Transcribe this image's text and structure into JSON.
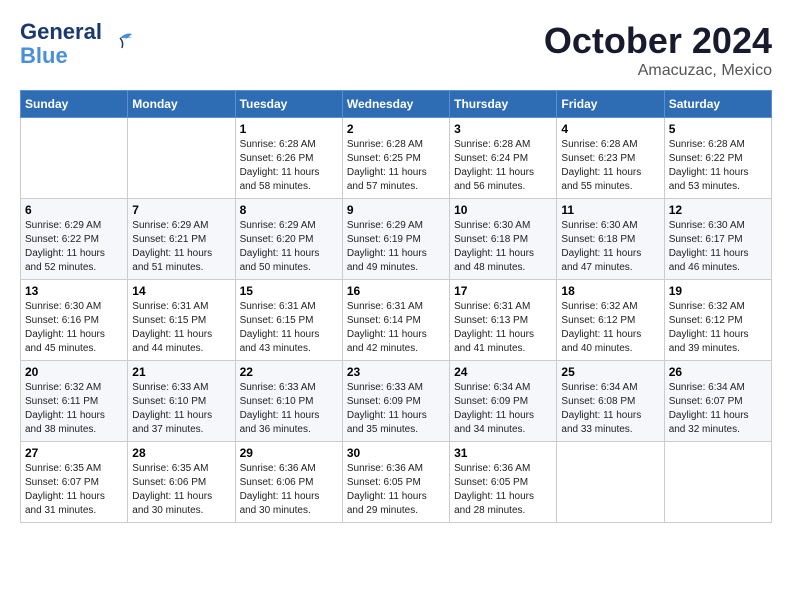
{
  "header": {
    "logo_line1": "General",
    "logo_line2": "Blue",
    "month": "October 2024",
    "location": "Amacuzac, Mexico"
  },
  "days_of_week": [
    "Sunday",
    "Monday",
    "Tuesday",
    "Wednesday",
    "Thursday",
    "Friday",
    "Saturday"
  ],
  "weeks": [
    [
      {
        "day": "",
        "info": ""
      },
      {
        "day": "",
        "info": ""
      },
      {
        "day": "1",
        "info": "Sunrise: 6:28 AM\nSunset: 6:26 PM\nDaylight: 11 hours and 58 minutes."
      },
      {
        "day": "2",
        "info": "Sunrise: 6:28 AM\nSunset: 6:25 PM\nDaylight: 11 hours and 57 minutes."
      },
      {
        "day": "3",
        "info": "Sunrise: 6:28 AM\nSunset: 6:24 PM\nDaylight: 11 hours and 56 minutes."
      },
      {
        "day": "4",
        "info": "Sunrise: 6:28 AM\nSunset: 6:23 PM\nDaylight: 11 hours and 55 minutes."
      },
      {
        "day": "5",
        "info": "Sunrise: 6:28 AM\nSunset: 6:22 PM\nDaylight: 11 hours and 53 minutes."
      }
    ],
    [
      {
        "day": "6",
        "info": "Sunrise: 6:29 AM\nSunset: 6:22 PM\nDaylight: 11 hours and 52 minutes."
      },
      {
        "day": "7",
        "info": "Sunrise: 6:29 AM\nSunset: 6:21 PM\nDaylight: 11 hours and 51 minutes."
      },
      {
        "day": "8",
        "info": "Sunrise: 6:29 AM\nSunset: 6:20 PM\nDaylight: 11 hours and 50 minutes."
      },
      {
        "day": "9",
        "info": "Sunrise: 6:29 AM\nSunset: 6:19 PM\nDaylight: 11 hours and 49 minutes."
      },
      {
        "day": "10",
        "info": "Sunrise: 6:30 AM\nSunset: 6:18 PM\nDaylight: 11 hours and 48 minutes."
      },
      {
        "day": "11",
        "info": "Sunrise: 6:30 AM\nSunset: 6:18 PM\nDaylight: 11 hours and 47 minutes."
      },
      {
        "day": "12",
        "info": "Sunrise: 6:30 AM\nSunset: 6:17 PM\nDaylight: 11 hours and 46 minutes."
      }
    ],
    [
      {
        "day": "13",
        "info": "Sunrise: 6:30 AM\nSunset: 6:16 PM\nDaylight: 11 hours and 45 minutes."
      },
      {
        "day": "14",
        "info": "Sunrise: 6:31 AM\nSunset: 6:15 PM\nDaylight: 11 hours and 44 minutes."
      },
      {
        "day": "15",
        "info": "Sunrise: 6:31 AM\nSunset: 6:15 PM\nDaylight: 11 hours and 43 minutes."
      },
      {
        "day": "16",
        "info": "Sunrise: 6:31 AM\nSunset: 6:14 PM\nDaylight: 11 hours and 42 minutes."
      },
      {
        "day": "17",
        "info": "Sunrise: 6:31 AM\nSunset: 6:13 PM\nDaylight: 11 hours and 41 minutes."
      },
      {
        "day": "18",
        "info": "Sunrise: 6:32 AM\nSunset: 6:12 PM\nDaylight: 11 hours and 40 minutes."
      },
      {
        "day": "19",
        "info": "Sunrise: 6:32 AM\nSunset: 6:12 PM\nDaylight: 11 hours and 39 minutes."
      }
    ],
    [
      {
        "day": "20",
        "info": "Sunrise: 6:32 AM\nSunset: 6:11 PM\nDaylight: 11 hours and 38 minutes."
      },
      {
        "day": "21",
        "info": "Sunrise: 6:33 AM\nSunset: 6:10 PM\nDaylight: 11 hours and 37 minutes."
      },
      {
        "day": "22",
        "info": "Sunrise: 6:33 AM\nSunset: 6:10 PM\nDaylight: 11 hours and 36 minutes."
      },
      {
        "day": "23",
        "info": "Sunrise: 6:33 AM\nSunset: 6:09 PM\nDaylight: 11 hours and 35 minutes."
      },
      {
        "day": "24",
        "info": "Sunrise: 6:34 AM\nSunset: 6:09 PM\nDaylight: 11 hours and 34 minutes."
      },
      {
        "day": "25",
        "info": "Sunrise: 6:34 AM\nSunset: 6:08 PM\nDaylight: 11 hours and 33 minutes."
      },
      {
        "day": "26",
        "info": "Sunrise: 6:34 AM\nSunset: 6:07 PM\nDaylight: 11 hours and 32 minutes."
      }
    ],
    [
      {
        "day": "27",
        "info": "Sunrise: 6:35 AM\nSunset: 6:07 PM\nDaylight: 11 hours and 31 minutes."
      },
      {
        "day": "28",
        "info": "Sunrise: 6:35 AM\nSunset: 6:06 PM\nDaylight: 11 hours and 30 minutes."
      },
      {
        "day": "29",
        "info": "Sunrise: 6:36 AM\nSunset: 6:06 PM\nDaylight: 11 hours and 30 minutes."
      },
      {
        "day": "30",
        "info": "Sunrise: 6:36 AM\nSunset: 6:05 PM\nDaylight: 11 hours and 29 minutes."
      },
      {
        "day": "31",
        "info": "Sunrise: 6:36 AM\nSunset: 6:05 PM\nDaylight: 11 hours and 28 minutes."
      },
      {
        "day": "",
        "info": ""
      },
      {
        "day": "",
        "info": ""
      }
    ]
  ]
}
